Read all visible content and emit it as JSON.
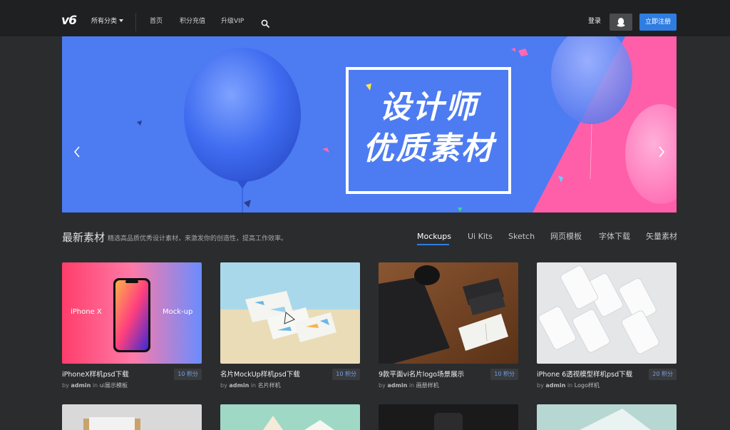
{
  "header": {
    "logo": "v6",
    "category_menu": "所有分类",
    "nav": [
      "首页",
      "积分充值",
      "升级VIP"
    ],
    "login": "登录",
    "register": "立即注册"
  },
  "banner": {
    "line1": "设计师",
    "line2": "优质素材"
  },
  "section": {
    "title": "最新素材",
    "desc": "精选高品质优秀设计素材，来激发你的创造性，提高工作效率。",
    "tabs": [
      "Mockups",
      "Ui Kits",
      "Sketch",
      "网页模板",
      "字体下载",
      "矢量素材"
    ],
    "active_tab": "Mockups"
  },
  "cards": [
    {
      "title": "iPhoneX样机psd下载",
      "points": "10 积分",
      "by": "by",
      "author": "admin",
      "in": "in",
      "category": "ui展示模板",
      "thumb_text_left": "iPhone X",
      "thumb_text_right": "Mock-up"
    },
    {
      "title": "名片MockUp样机psd下载",
      "points": "10 积分",
      "by": "by",
      "author": "admin",
      "in": "in",
      "category": "名片样机"
    },
    {
      "title": "9款平面vi名片logo场景展示",
      "points": "10 积分",
      "by": "by",
      "author": "admin",
      "in": "in",
      "category": "画册样机"
    },
    {
      "title": "iPhone 6透视模型样机psd下载",
      "points": "20 积分",
      "by": "by",
      "author": "admin",
      "in": "in",
      "category": "Logo样机"
    }
  ],
  "colors": {
    "accent": "#2f7de1",
    "background": "#2b2c2e",
    "header": "#1f2022",
    "banner_blue": "#4d7bf2",
    "banner_pink": "#ff5fa8"
  },
  "icons": [
    "search-icon",
    "qq-icon",
    "chevron-left-icon",
    "chevron-right-icon",
    "caret-down-icon"
  ]
}
